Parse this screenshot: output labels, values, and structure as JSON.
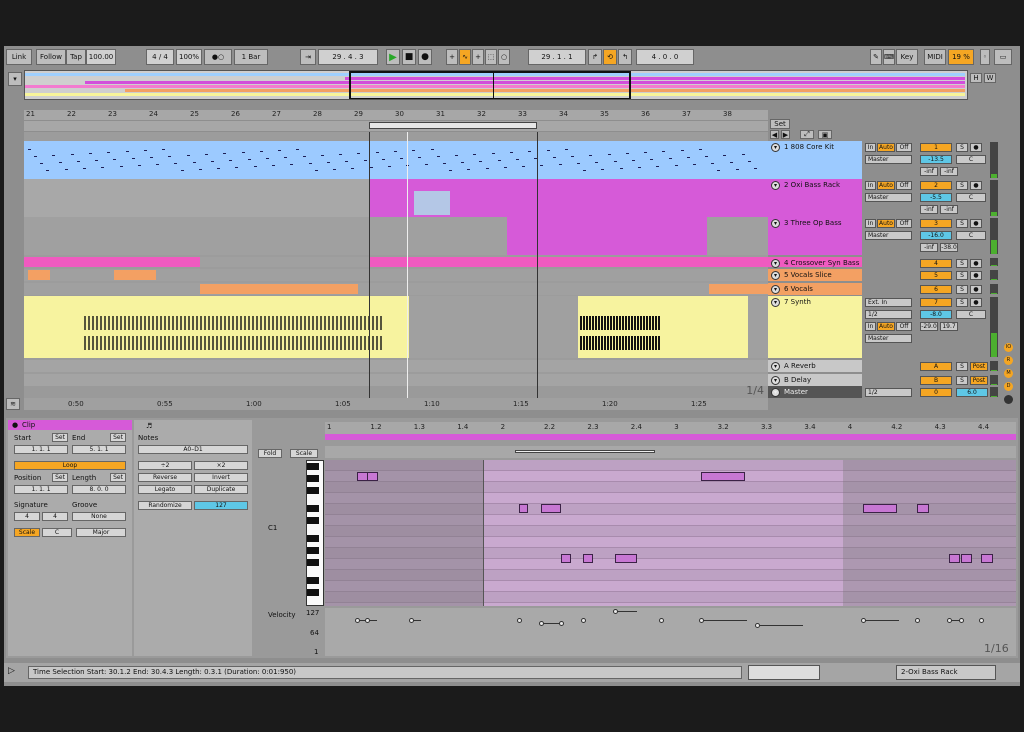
{
  "transport": {
    "link": "Link",
    "follow": "Follow",
    "tap": "Tap",
    "tempo": "100.00",
    "signature": "4 / 4",
    "zoom": "100%",
    "metro": "●○",
    "quantize": "1 Bar",
    "position": "29 .  4 .  3",
    "loop_start": "29 .  1 .  1",
    "loop_length": "4 .  0 .  0",
    "key": "Key",
    "midi": "MIDI",
    "cpu": "19 %"
  },
  "overview": {
    "h": "H",
    "w": "W"
  },
  "arrangement": {
    "bars": [
      "21",
      "22",
      "23",
      "24",
      "25",
      "26",
      "27",
      "28",
      "29",
      "30",
      "31",
      "32",
      "33",
      "34",
      "35",
      "36",
      "37",
      "38"
    ],
    "set_label": "Set",
    "page_label": "1/4",
    "time_labels": [
      "0:50",
      "0:55",
      "1:00",
      "1:05",
      "1:10",
      "1:15",
      "1:20",
      "1:25"
    ]
  },
  "tracks": [
    {
      "name": "1 808 Core Kit",
      "num": "1",
      "in": "In",
      "auto": "Auto",
      "off": "Off",
      "route": "Master",
      "vol": "-13.5",
      "pan": "C",
      "peak1": "-inf",
      "peak2": "-inf",
      "s": "S"
    },
    {
      "name": "2 Oxi Bass Rack",
      "num": "2",
      "in": "In",
      "auto": "Auto",
      "off": "Off",
      "route": "Master",
      "vol": "-5.5",
      "pan": "C",
      "peak1": "-inf",
      "peak2": "-inf",
      "s": "S"
    },
    {
      "name": "3 Three Op Bass",
      "num": "3",
      "in": "In",
      "auto": "Auto",
      "off": "Off",
      "route": "Master",
      "vol": "-16.0",
      "pan": "C",
      "peak1": "-inf",
      "peak2": "-38.0",
      "s": "S"
    },
    {
      "name": "4 Crossover Syn Bass",
      "num": "4",
      "s": "S"
    },
    {
      "name": "5 Vocals Slice",
      "num": "5",
      "s": "S"
    },
    {
      "name": "6 Vocals",
      "num": "6",
      "s": "S"
    },
    {
      "name": "7 Synth",
      "num": "7",
      "ext": "Ext. In",
      "ch": "1/2",
      "in": "In",
      "auto": "Auto",
      "off": "Off",
      "route": "Master",
      "vol": "-8.0",
      "pan": "C",
      "peak1": "-29.0",
      "peak2": "19.7",
      "s": "S"
    },
    {
      "name": "A Reverb",
      "num": "A",
      "s": "S",
      "post": "Post"
    },
    {
      "name": "B Delay",
      "num": "B",
      "s": "S",
      "post": "Post"
    },
    {
      "name": "Master",
      "num": "0",
      "ch": "1/2",
      "vol": "6.0"
    }
  ],
  "clip": {
    "title": "Clip",
    "start": "Start",
    "set": "Set",
    "end": "End",
    "start_val": "1.   1.   1",
    "end_val": "5.   1.   1",
    "loop": "Loop",
    "position": "Position",
    "length": "Length",
    "pos_val": "1.   1.   1",
    "len_val": "8.   0.   0",
    "signature": "Signature",
    "groove": "Groove",
    "sig_num": "4",
    "sig_den": "4",
    "groove_val": "None",
    "scale": "Scale",
    "key": "C",
    "mode": "Major"
  },
  "notes": {
    "title": "Notes",
    "range": "A0–D1",
    "div2": "÷2",
    "x2": "×2",
    "reverse": "Reverse",
    "invert": "Invert",
    "legato": "Legato",
    "duplicate": "Duplicate",
    "randomize": "Randomize",
    "vel": "127",
    "fold": "Fold",
    "scalebtn": "Scale",
    "c1": "C1",
    "velocity": "Velocity",
    "v127": "127",
    "v64": "64",
    "v1": "1",
    "page": "1/16"
  },
  "editor": {
    "bars": [
      "1",
      "1.2",
      "1.3",
      "1.4",
      "2",
      "2.2",
      "2.3",
      "2.4",
      "3",
      "3.2",
      "3.3",
      "3.4",
      "4",
      "4.2",
      "4.3",
      "4.4"
    ]
  },
  "status": {
    "text": "Time Selection   Start: 30.1.2   End: 30.4.3   Length: 0.3.1  (Duration: 0:01:950)",
    "track": "2-Oxi Bass Rack"
  }
}
